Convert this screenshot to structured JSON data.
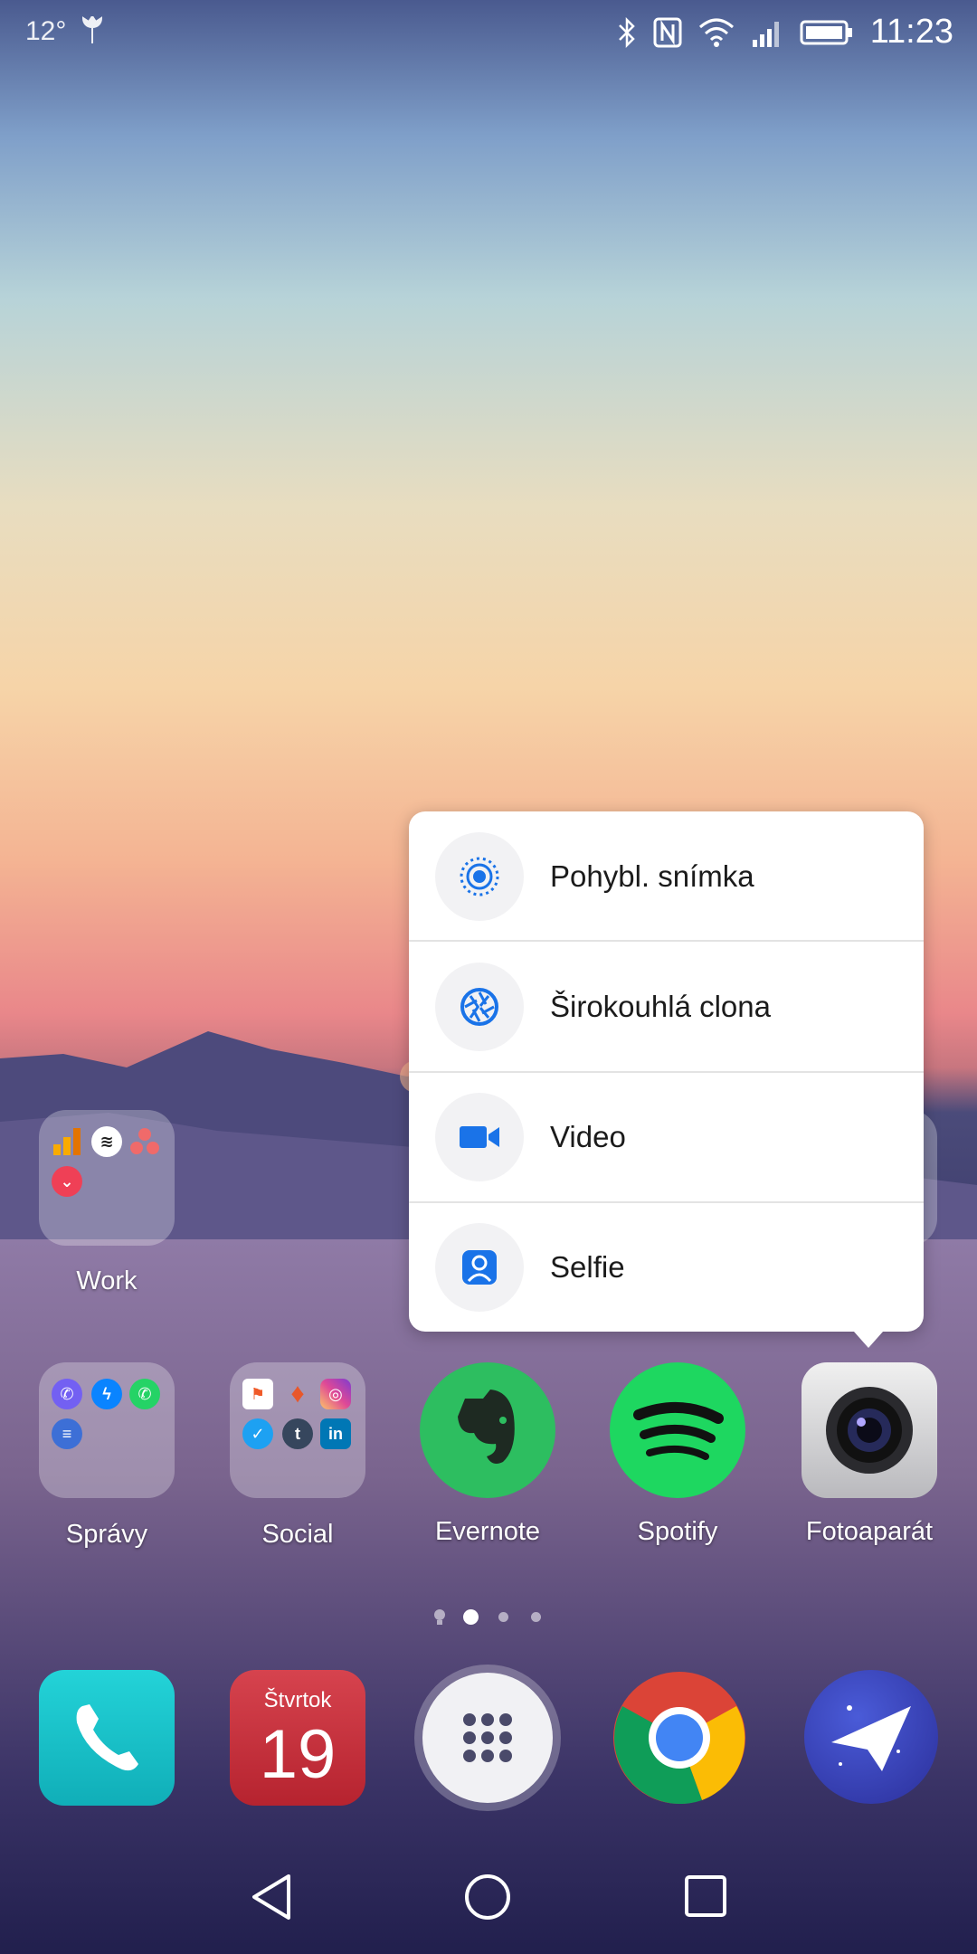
{
  "status_bar": {
    "temperature": "12°",
    "time": "11:23",
    "icons": [
      "weather-icon",
      "bluetooth-icon",
      "nfc-icon",
      "wifi-icon",
      "cell-signal-icon",
      "battery-icon"
    ]
  },
  "camera_shortcuts": {
    "items": [
      {
        "label": "Pohybl. snímka",
        "icon": "moving-picture-icon"
      },
      {
        "label": "Širokouhlá clona",
        "icon": "aperture-icon"
      },
      {
        "label": "Video",
        "icon": "video-camera-icon"
      },
      {
        "label": "Selfie",
        "icon": "selfie-icon"
      }
    ],
    "accent_color": "#1a73e8"
  },
  "home": {
    "work_folder": {
      "label": "Work"
    },
    "row2": [
      {
        "label": "Správy"
      },
      {
        "label": "Social"
      },
      {
        "label": "Evernote"
      },
      {
        "label": "Spotify"
      },
      {
        "label": "Fotoaparát"
      }
    ]
  },
  "dock": {
    "calendar": {
      "day_name": "Štvrtok",
      "day_number": "19"
    }
  },
  "colors": {
    "evernote": "#2dbe60",
    "spotify": "#1ed760",
    "phone": "#19c1c9",
    "calendar": "#c9343f"
  }
}
